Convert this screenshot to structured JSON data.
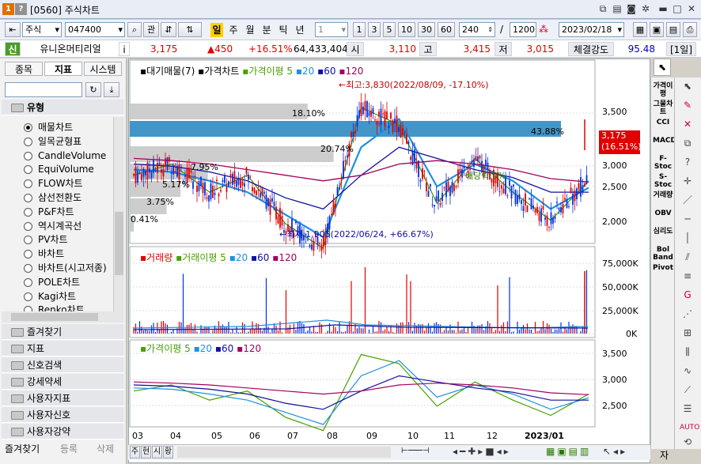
{
  "window": {
    "title": "[0560] 주식차트",
    "icon_labels": [
      "1",
      "?"
    ]
  },
  "toolbar": {
    "market": "주식",
    "code": "047400",
    "link_label": "관",
    "periods": [
      "일",
      "주",
      "월",
      "분",
      "틱",
      "년"
    ],
    "interval_value": "1",
    "quick_intervals": [
      "1",
      "3",
      "5",
      "10",
      "30",
      "60"
    ],
    "display_count": "240",
    "total_count": "1200",
    "slash": "/",
    "date": "2023/02/18"
  },
  "info": {
    "badge": "신",
    "name": "유니온머티리얼",
    "price": "3,175",
    "change": "▲450",
    "change_pct": "+16.51%",
    "volume": "64,433,404",
    "open_label": "시",
    "open": "3,110",
    "high_label": "고",
    "high": "3,415",
    "low_label": "저",
    "low": "3,015",
    "strength_label": "체결강도",
    "strength": "95.48",
    "period_badge": "[1일]",
    "info_icon": "i"
  },
  "left_panel": {
    "tabs": [
      "종목",
      "지표",
      "시스템"
    ],
    "group_title": "유형",
    "chart_types": [
      "매물차트",
      "일목균형표",
      "CandleVolume",
      "EquiVolume",
      "FLOW차트",
      "삼선전환도",
      "P&F차트",
      "역시계곡선",
      "PV차트",
      "바차트",
      "바차트(시고저종)",
      "POLE차트",
      "Kagi차트",
      "Renko차트"
    ],
    "selected_index": 0,
    "folders": [
      "즐겨찾기",
      "지표",
      "신호검색",
      "강세약세",
      "사용자지표",
      "사용자신호",
      "사용자강약"
    ],
    "bottom_tabs": [
      "즐겨찾기",
      "등록",
      "삭제"
    ]
  },
  "chart": {
    "price_legend": {
      "volume_profile": "대기매물(7)",
      "price": "가격차트",
      "ma_label": "가격이평",
      "ma": [
        "5",
        "20",
        "60",
        "120"
      ]
    },
    "volume_legend": {
      "volume": "거래량",
      "ma_label": "거래이평",
      "ma": [
        "5",
        "20",
        "60",
        "120"
      ]
    },
    "ma_legend": {
      "ma_label": "가격이평",
      "ma": [
        "5",
        "20",
        "60",
        "120"
      ]
    },
    "price_axis": [
      "3,500",
      "3,000",
      "2,500",
      "2,000"
    ],
    "volume_axis": [
      "75,000K",
      "50,000K",
      "25,000K",
      "0K"
    ],
    "ma_axis": [
      "3,500",
      "3,000",
      "2,500"
    ],
    "current_price_tag": [
      "3,175",
      "(16.51%)"
    ],
    "high_annotation": "←최고:3,830(2022/08/09, -17.10%)",
    "low_annotation": "←최저:1,905(2022/06/24, +66.67%)",
    "dividend_annotation": "배당락:0%",
    "volume_profile_pct": [
      "18.10%",
      "43.88%",
      "20.74%",
      "7.95%",
      "5.17%",
      "3.75%",
      "0.41%"
    ],
    "x_labels": [
      "03",
      "04",
      "05",
      "06",
      "07",
      "08",
      "09",
      "10",
      "11",
      "12",
      "2023/01"
    ],
    "colors": {
      "ma5": "#4aa000",
      "ma20": "#1e90e0",
      "ma60": "#1010a0",
      "ma120": "#a00060",
      "up": "#e00000",
      "down": "#0030e0"
    }
  },
  "chart_data": [
    {
      "type": "bar",
      "title": "",
      "categories": [
        "0.41%",
        "3.75%",
        "5.17%",
        "7.95%",
        "20.74%",
        "43.88%",
        "18.10%"
      ],
      "values": [
        0.41,
        3.75,
        5.17,
        7.95,
        20.74,
        43.88,
        18.1
      ],
      "ylabel": "",
      "note": ""
    },
    {
      "type": "line",
      "series": [
        {
          "name": "5",
          "values": [
            2850,
            2950,
            2700,
            2850,
            2420,
            2200,
            3450,
            3300,
            2600,
            3000,
            2700,
            2450,
            2800
          ]
        },
        {
          "name": "20",
          "values": [
            2900,
            2880,
            2800,
            2700,
            2500,
            2300,
            3100,
            3350,
            2750,
            2950,
            2800,
            2550,
            2740
          ]
        },
        {
          "name": "60",
          "values": [
            2950,
            2930,
            2880,
            2800,
            2650,
            2550,
            2850,
            3100,
            3000,
            2900,
            2830,
            2700,
            2700
          ]
        },
        {
          "name": "120",
          "values": [
            3000,
            2980,
            2950,
            2900,
            2850,
            2800,
            2850,
            2950,
            2980,
            2950,
            2900,
            2820,
            2790
          ]
        }
      ],
      "x": [
        "03",
        "04",
        "05",
        "06",
        "07",
        "08",
        "09",
        "10",
        "11",
        "12",
        "2023/01",
        "",
        ""
      ],
      "ylim": [
        2300,
        3600
      ]
    }
  ],
  "right_tools": {
    "indicators": [
      "가격이평",
      "그물차트",
      "CCI",
      "MACD",
      "F-Stoc",
      "S-Stoc",
      "거래량",
      "OBV",
      "심리도",
      "Bol Band",
      "Pivot"
    ],
    "bottom_label": "자"
  },
  "bottom_bar": {
    "tabs": [
      "주",
      "현",
      "시",
      "황"
    ]
  }
}
